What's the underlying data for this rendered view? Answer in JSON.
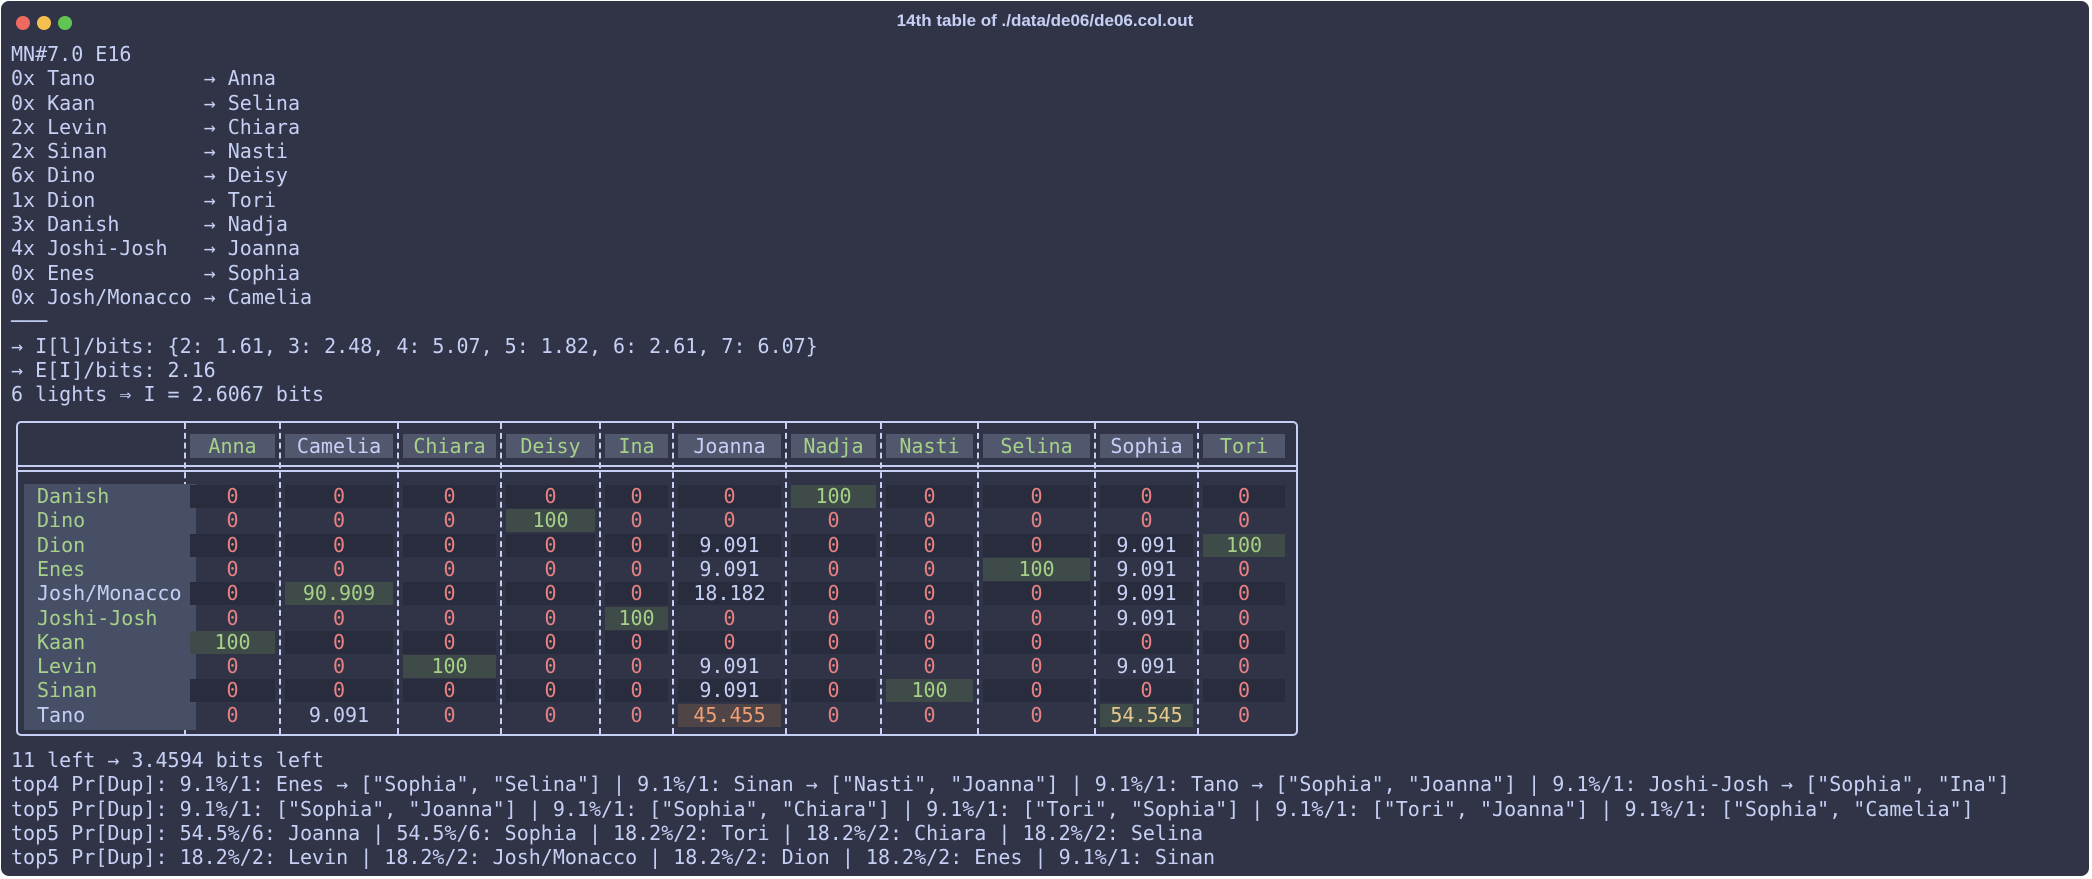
{
  "window": {
    "title": "14th table of ./data/de06/de06.col.out",
    "controls": [
      {
        "name": "close",
        "color": "#ed6a5e"
      },
      {
        "name": "minimize",
        "color": "#f5bf4f"
      },
      {
        "name": "zoom",
        "color": "#61c554"
      }
    ]
  },
  "colors": {
    "background": "#303446",
    "text": "#c6d0f5",
    "green": "#a6d189",
    "red": "#e78284",
    "yellow": "#e5c890",
    "peach": "#ef9f76",
    "cell_dark": "#292c3c",
    "cell_green": "#3f4b48",
    "cell_peach": "#4f4446",
    "header_cell": "#51576d",
    "name_column": "#474f67"
  },
  "terminal": {
    "header_lines": [
      "MN#7.0 E16",
      "0x Tano         → Anna",
      "0x Kaan         → Selina",
      "2x Levin        → Chiara",
      "2x Sinan        → Nasti",
      "6x Dino         → Deisy",
      "1x Dion         → Tori",
      "3x Danish       → Nadja",
      "4x Joshi-Josh   → Joanna",
      "0x Enes         → Sophia",
      "0x Josh/Monacco → Camelia",
      "───",
      "→ I[l]/bits: {2: 1.61, 3: 2.48, 4: 5.07, 5: 1.82, 6: 2.61, 7: 6.07}",
      "→ E[I]/bits: 2.16",
      "6 lights ⇒ I = 2.6067 bits"
    ],
    "footer_lines": [
      "11 left → 3.4594 bits left",
      "top4 Pr[Dup]: 9.1%/1: Enes → [\"Sophia\", \"Selina\"] | 9.1%/1: Sinan → [\"Nasti\", \"Joanna\"] | 9.1%/1: Tano → [\"Sophia\", \"Joanna\"] | 9.1%/1: Joshi-Josh → [\"Sophia\", \"Ina\"]",
      "top5 Pr[Dup]: 9.1%/1: [\"Sophia\", \"Joanna\"] | 9.1%/1: [\"Sophia\", \"Chiara\"] | 9.1%/1: [\"Tori\", \"Sophia\"] | 9.1%/1: [\"Tori\", \"Joanna\"] | 9.1%/1: [\"Sophia\", \"Camelia\"]",
      "top5 Pr[Dup]: 54.5%/6: Joanna | 54.5%/6: Sophia | 18.2%/2: Tori | 18.2%/2: Chiara | 18.2%/2: Selina",
      "top5 Pr[Dup]: 18.2%/2: Levin | 18.2%/2: Josh/Monacco | 18.2%/2: Dion | 18.2%/2: Enes | 9.1%/1: Sinan"
    ]
  },
  "table": {
    "columns": [
      {
        "name": "Anna",
        "color": "green"
      },
      {
        "name": "Camelia",
        "color": "text"
      },
      {
        "name": "Chiara",
        "color": "green"
      },
      {
        "name": "Deisy",
        "color": "green"
      },
      {
        "name": "Ina",
        "color": "green"
      },
      {
        "name": "Joanna",
        "color": "text"
      },
      {
        "name": "Nadja",
        "color": "green"
      },
      {
        "name": "Nasti",
        "color": "green"
      },
      {
        "name": "Selina",
        "color": "green"
      },
      {
        "name": "Sophia",
        "color": "text"
      },
      {
        "name": "Tori",
        "color": "green"
      }
    ],
    "rows": [
      {
        "name": "Danish",
        "color": "green",
        "cells": [
          "0",
          "0",
          "0",
          "0",
          "0",
          "0",
          "100",
          "0",
          "0",
          "0",
          "0"
        ]
      },
      {
        "name": "Dino",
        "color": "green",
        "cells": [
          "0",
          "0",
          "0",
          "100",
          "0",
          "0",
          "0",
          "0",
          "0",
          "0",
          "0"
        ]
      },
      {
        "name": "Dion",
        "color": "green",
        "cells": [
          "0",
          "0",
          "0",
          "0",
          "0",
          "9.091",
          "0",
          "0",
          "0",
          "9.091",
          "100"
        ]
      },
      {
        "name": "Enes",
        "color": "green",
        "cells": [
          "0",
          "0",
          "0",
          "0",
          "0",
          "9.091",
          "0",
          "0",
          "100",
          "9.091",
          "0"
        ]
      },
      {
        "name": "Josh/Monacco",
        "color": "text",
        "cells": [
          "0",
          "90.909",
          "0",
          "0",
          "0",
          "18.182",
          "0",
          "0",
          "0",
          "9.091",
          "0"
        ]
      },
      {
        "name": "Joshi-Josh",
        "color": "green",
        "cells": [
          "0",
          "0",
          "0",
          "0",
          "100",
          "0",
          "0",
          "0",
          "0",
          "9.091",
          "0"
        ]
      },
      {
        "name": "Kaan",
        "color": "green",
        "cells": [
          "100",
          "0",
          "0",
          "0",
          "0",
          "0",
          "0",
          "0",
          "0",
          "0",
          "0"
        ]
      },
      {
        "name": "Levin",
        "color": "green",
        "cells": [
          "0",
          "0",
          "100",
          "0",
          "0",
          "9.091",
          "0",
          "0",
          "0",
          "9.091",
          "0"
        ]
      },
      {
        "name": "Sinan",
        "color": "green",
        "cells": [
          "0",
          "0",
          "0",
          "0",
          "0",
          "9.091",
          "0",
          "100",
          "0",
          "0",
          "0"
        ]
      },
      {
        "name": "Tano",
        "color": "text",
        "cells": [
          "0",
          "9.091",
          "0",
          "0",
          "0",
          "45.455",
          "0",
          "0",
          "0",
          "54.545",
          "0"
        ]
      }
    ]
  }
}
